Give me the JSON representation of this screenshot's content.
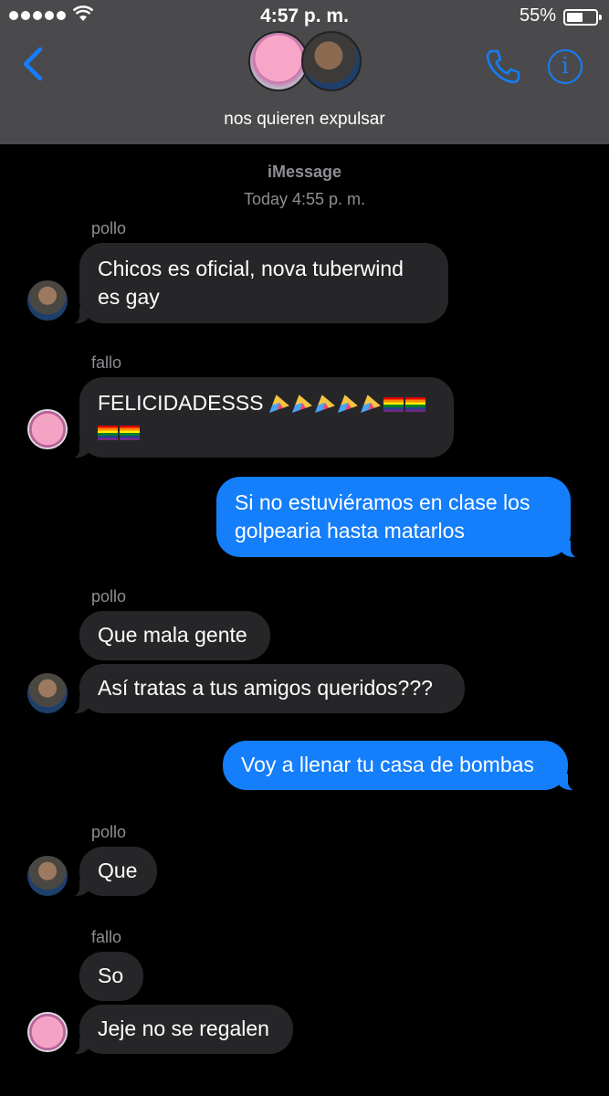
{
  "status_bar": {
    "time": "4:57 p. m.",
    "battery_percent": "55%",
    "battery_level": 0.55
  },
  "header": {
    "group_name": "nos quieren expulsar",
    "icons": [
      "chevron-left-icon",
      "phone-icon",
      "info-icon"
    ],
    "accent_color": "#147efb",
    "background_color": "#4a4a4c"
  },
  "conversation": {
    "service": "iMessage",
    "timestamp": "Today 4:55 p. m.",
    "messages": [
      {
        "sender": "pollo",
        "text_lines": [
          "Chicos es oficial, nova tuberwind",
          "es gay"
        ],
        "direction": "in"
      },
      {
        "sender": "fallo",
        "text": "FELICIDADESSS",
        "emoji_summary": "5 party-popper emoji, 4 rainbow-flag emoji",
        "direction": "in"
      },
      {
        "text_lines": [
          "Si no estuviéramos en clase los",
          "golpearia hasta matarlos"
        ],
        "direction": "out"
      },
      {
        "sender": "pollo",
        "text": "Que mala gente",
        "direction": "in"
      },
      {
        "text": "Así tratas a tus amigos queridos???",
        "direction": "in"
      },
      {
        "text": "Voy a llenar tu casa de bombas",
        "direction": "out"
      },
      {
        "sender": "pollo",
        "text": "Que",
        "direction": "in"
      },
      {
        "sender": "fallo",
        "text": "So",
        "direction": "in"
      },
      {
        "text": "Jeje no se regalen",
        "direction": "in"
      }
    ]
  },
  "colors": {
    "incoming_bubble": "#262629",
    "outgoing_bubble": "#147efb",
    "meta_text": "#8e8e93"
  }
}
